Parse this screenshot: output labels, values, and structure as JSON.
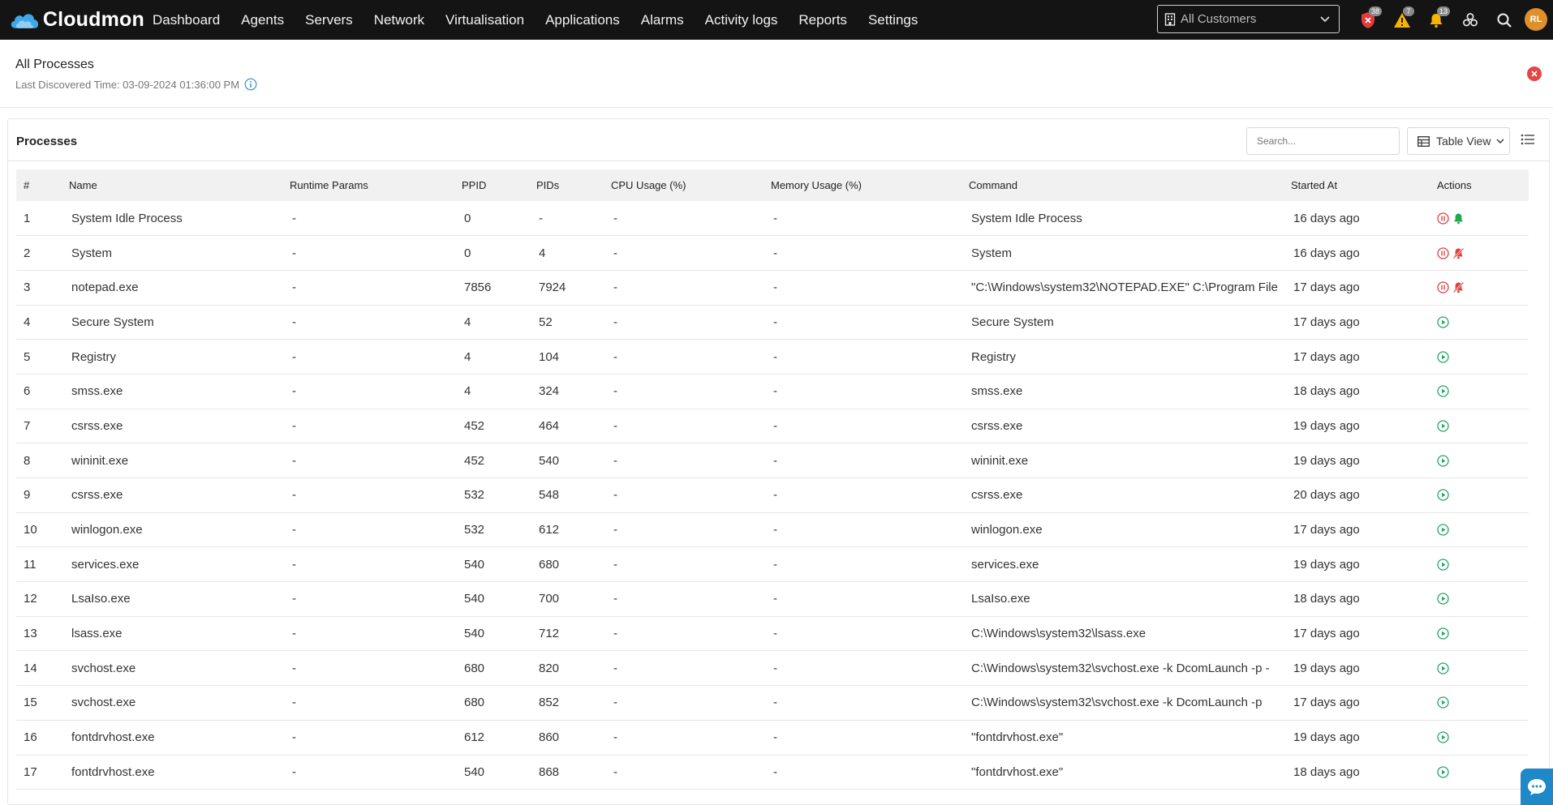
{
  "app": {
    "name": "Cloudmon"
  },
  "nav": [
    "Dashboard",
    "Agents",
    "Servers",
    "Network",
    "Virtualisation",
    "Applications",
    "Alarms",
    "Activity logs",
    "Reports",
    "Settings"
  ],
  "customer_select": {
    "value": "All Customers"
  },
  "top_icons": {
    "shield_badge": "38",
    "warning_badge": "7",
    "bell_badge": "13"
  },
  "user": {
    "initials": "RL"
  },
  "page": {
    "title": "All Processes",
    "subtitle": "Last Discovered Time: 03-09-2024 01:36:00 PM"
  },
  "processes": {
    "title": "Processes",
    "search_placeholder": "Search...",
    "view_label": "Table View",
    "columns": [
      "#",
      "Name",
      "Runtime Params",
      "PPID",
      "PIDs",
      "CPU Usage (%)",
      "Memory Usage (%)",
      "Command",
      "Started At",
      "Actions"
    ],
    "rows": [
      {
        "num": "1",
        "name": "System Idle Process",
        "rp": "-",
        "ppid": "0",
        "pids": "-",
        "cpu": "-",
        "mem": "-",
        "cmd": "System Idle Process",
        "started": "16 days ago",
        "actions": [
          "pause",
          "bell"
        ]
      },
      {
        "num": "2",
        "name": "System",
        "rp": "-",
        "ppid": "0",
        "pids": "4",
        "cpu": "-",
        "mem": "-",
        "cmd": "System",
        "started": "16 days ago",
        "actions": [
          "pause",
          "bell-off"
        ]
      },
      {
        "num": "3",
        "name": "notepad.exe",
        "rp": "-",
        "ppid": "7856",
        "pids": "7924",
        "cpu": "-",
        "mem": "-",
        "cmd": "\"C:\\Windows\\system32\\NOTEPAD.EXE\" C:\\Program File",
        "started": "17 days ago",
        "actions": [
          "pause",
          "bell-off"
        ]
      },
      {
        "num": "4",
        "name": "Secure System",
        "rp": "-",
        "ppid": "4",
        "pids": "52",
        "cpu": "-",
        "mem": "-",
        "cmd": "Secure System",
        "started": "17 days ago",
        "actions": [
          "play"
        ]
      },
      {
        "num": "5",
        "name": "Registry",
        "rp": "-",
        "ppid": "4",
        "pids": "104",
        "cpu": "-",
        "mem": "-",
        "cmd": "Registry",
        "started": "17 days ago",
        "actions": [
          "play"
        ]
      },
      {
        "num": "6",
        "name": "smss.exe",
        "rp": "-",
        "ppid": "4",
        "pids": "324",
        "cpu": "-",
        "mem": "-",
        "cmd": "smss.exe",
        "started": "18 days ago",
        "actions": [
          "play"
        ]
      },
      {
        "num": "7",
        "name": "csrss.exe",
        "rp": "-",
        "ppid": "452",
        "pids": "464",
        "cpu": "-",
        "mem": "-",
        "cmd": "csrss.exe",
        "started": "19 days ago",
        "actions": [
          "play"
        ]
      },
      {
        "num": "8",
        "name": "wininit.exe",
        "rp": "-",
        "ppid": "452",
        "pids": "540",
        "cpu": "-",
        "mem": "-",
        "cmd": "wininit.exe",
        "started": "19 days ago",
        "actions": [
          "play"
        ]
      },
      {
        "num": "9",
        "name": "csrss.exe",
        "rp": "-",
        "ppid": "532",
        "pids": "548",
        "cpu": "-",
        "mem": "-",
        "cmd": "csrss.exe",
        "started": "20 days ago",
        "actions": [
          "play"
        ]
      },
      {
        "num": "10",
        "name": "winlogon.exe",
        "rp": "-",
        "ppid": "532",
        "pids": "612",
        "cpu": "-",
        "mem": "-",
        "cmd": "winlogon.exe",
        "started": "17 days ago",
        "actions": [
          "play"
        ]
      },
      {
        "num": "11",
        "name": "services.exe",
        "rp": "-",
        "ppid": "540",
        "pids": "680",
        "cpu": "-",
        "mem": "-",
        "cmd": "services.exe",
        "started": "19 days ago",
        "actions": [
          "play"
        ]
      },
      {
        "num": "12",
        "name": "LsaIso.exe",
        "rp": "-",
        "ppid": "540",
        "pids": "700",
        "cpu": "-",
        "mem": "-",
        "cmd": "LsaIso.exe",
        "started": "18 days ago",
        "actions": [
          "play"
        ]
      },
      {
        "num": "13",
        "name": "lsass.exe",
        "rp": "-",
        "ppid": "540",
        "pids": "712",
        "cpu": "-",
        "mem": "-",
        "cmd": "C:\\Windows\\system32\\lsass.exe",
        "started": "17 days ago",
        "actions": [
          "play"
        ]
      },
      {
        "num": "14",
        "name": "svchost.exe",
        "rp": "-",
        "ppid": "680",
        "pids": "820",
        "cpu": "-",
        "mem": "-",
        "cmd": "C:\\Windows\\system32\\svchost.exe -k DcomLaunch -p -",
        "started": "19 days ago",
        "actions": [
          "play"
        ]
      },
      {
        "num": "15",
        "name": "svchost.exe",
        "rp": "-",
        "ppid": "680",
        "pids": "852",
        "cpu": "-",
        "mem": "-",
        "cmd": "C:\\Windows\\system32\\svchost.exe -k DcomLaunch -p",
        "started": "17 days ago",
        "actions": [
          "play"
        ]
      },
      {
        "num": "16",
        "name": "fontdrvhost.exe",
        "rp": "-",
        "ppid": "612",
        "pids": "860",
        "cpu": "-",
        "mem": "-",
        "cmd": "\"fontdrvhost.exe\"",
        "started": "19 days ago",
        "actions": [
          "play"
        ]
      },
      {
        "num": "17",
        "name": "fontdrvhost.exe",
        "rp": "-",
        "ppid": "540",
        "pids": "868",
        "cpu": "-",
        "mem": "-",
        "cmd": "\"fontdrvhost.exe\"",
        "started": "18 days ago",
        "actions": [
          "play"
        ]
      }
    ]
  },
  "colors": {
    "topbar": "#141414",
    "pause_red": "#e0413f",
    "play_green": "#2aa56a",
    "close_red": "#e04848",
    "chat_blue": "#1e88c9",
    "avatar": "#e0902a"
  }
}
